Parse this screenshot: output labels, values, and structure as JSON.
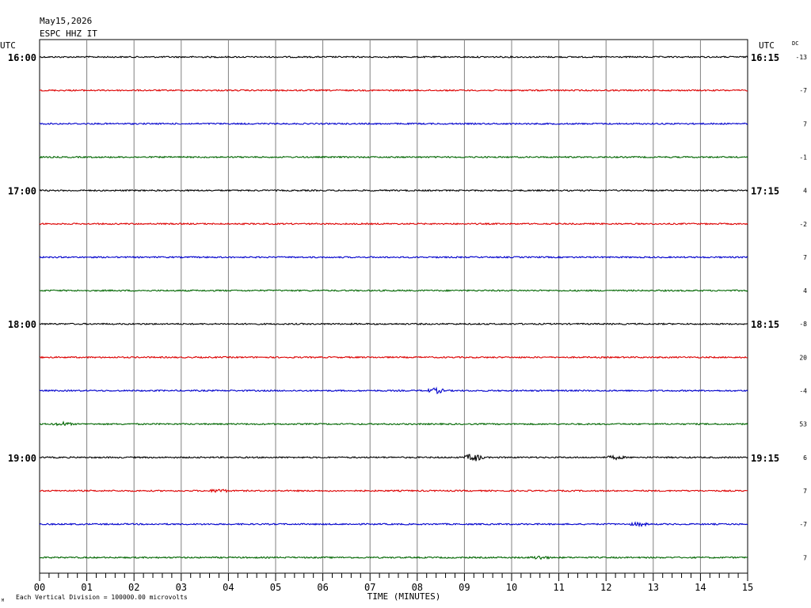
{
  "header": {
    "date": "May15,2026",
    "station": "ESPC HHZ IT"
  },
  "labels": {
    "utc_left": "UTC",
    "utc_right": "UTC",
    "dc": "DC",
    "xlabel": "TIME (MINUTES)",
    "footer": "Each Vertical Division = 100000.00 microvolts",
    "corner_mark": "M"
  },
  "chart_data": {
    "type": "line",
    "x_ticks": [
      "00",
      "01",
      "02",
      "03",
      "04",
      "05",
      "06",
      "07",
      "08",
      "09",
      "10",
      "11",
      "12",
      "13",
      "14",
      "15"
    ],
    "xlim": [
      0,
      15
    ],
    "xlabel": "TIME (MINUTES)",
    "grid": true,
    "trace_colors": [
      "#000000",
      "#dd0000",
      "#0000cc",
      "#006600"
    ],
    "left_hour_labels": [
      {
        "row": 0,
        "text": "16:00"
      },
      {
        "row": 4,
        "text": "17:00"
      },
      {
        "row": 8,
        "text": "18:00"
      },
      {
        "row": 12,
        "text": "19:00"
      }
    ],
    "right_hour_labels": [
      {
        "row": 0,
        "text": "16:15"
      },
      {
        "row": 4,
        "text": "17:15"
      },
      {
        "row": 8,
        "text": "18:15"
      },
      {
        "row": 12,
        "text": "19:15"
      }
    ],
    "dc_offsets": [
      "-13",
      "-7",
      "7",
      "-1",
      "4",
      "-2",
      "7",
      "4",
      "-8",
      "20",
      "-4",
      "53",
      "6",
      "7",
      "-7",
      "7"
    ],
    "events": [
      {
        "row": 10,
        "minute": 8.4,
        "strength": 3
      },
      {
        "row": 12,
        "minute": 9.2,
        "strength": 5
      },
      {
        "row": 12,
        "minute": 12.2,
        "strength": 2
      },
      {
        "row": 13,
        "minute": 3.8,
        "strength": 2
      },
      {
        "row": 14,
        "minute": 12.7,
        "strength": 2
      },
      {
        "row": 11,
        "minute": 0.5,
        "strength": 2
      },
      {
        "row": 15,
        "minute": 10.6,
        "strength": 2
      }
    ]
  }
}
